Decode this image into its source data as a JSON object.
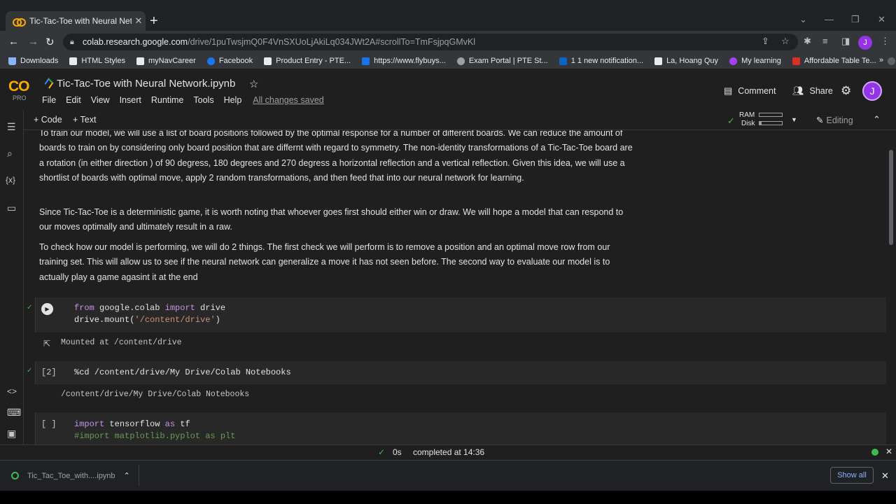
{
  "browser": {
    "tab_title": "Tic-Tac-Toe with Neural Network",
    "url_domain": "colab.research.google.com",
    "url_path": "/drive/1puTwsjmQ0F4VnSXUoLjAkiLq034JWt2A#scrollTo=TmFsjpqGMvKl",
    "profile_initial": "J"
  },
  "bookmarks": [
    {
      "label": "Downloads",
      "color": "#8ab4f8"
    },
    {
      "label": "HTML Styles",
      "color": "#e8eaed"
    },
    {
      "label": "myNavCareer",
      "color": "#e8eaed"
    },
    {
      "label": "Facebook",
      "color": "#1877f2"
    },
    {
      "label": "Product Entry - PTE...",
      "color": "#e8eaed"
    },
    {
      "label": "https://www.flybuys...",
      "color": "#1a73e8"
    },
    {
      "label": "Exam Portal | PTE St...",
      "color": "#9aa0a6"
    },
    {
      "label": "1 1 new notification...",
      "color": "#0a66c2"
    },
    {
      "label": "La, Hoang Quy",
      "color": "#e8eaed"
    },
    {
      "label": "My learning",
      "color": "#a142f4"
    },
    {
      "label": "Affordable Table Te...",
      "color": "#d93025"
    }
  ],
  "colab": {
    "logo": "CO",
    "pro_label": "PRO",
    "notebook_title": "Tic-Tac-Toe with Neural Network.ipynb",
    "menu": [
      "File",
      "Edit",
      "View",
      "Insert",
      "Runtime",
      "Tools",
      "Help"
    ],
    "saved_status": "All changes saved",
    "comment_label": "Comment",
    "share_label": "Share",
    "avatar_initial": "J",
    "add_code": "+ Code",
    "add_text": "+ Text",
    "ram_label": "RAM",
    "disk_label": "Disk",
    "editing_label": "Editing"
  },
  "text_cells": [
    "To train our model, we will use a list of board positions followed by the optimal response for a number of different boards. We can reduce the amount of boards to train on by considering only board position that are differnt with regard to symmetry. The non-identity transformations of a Tic-Tac-Toe board are a rotation (in either direction ) of 90 degress, 180 degrees and 270 degress a horizontal reflection and a vertical reflection. Given this idea, we will use a shortlist of boards with optimal move, apply 2 random transformations, and then feed that into our neural network for learning.",
    "Since Tic-Tac-Toe is a deterministic game, it is worth noting that whoever goes first should either win or draw. We will hope a model that can respond to our moves optimally and ultimately result in a raw.",
    "To check how our model is performing, we will do 2 things. The first check we will perform is to remove a position and an optimal move row from our training set. This will allow us to see if the neural network can generalize a move it has not seen before. The second way to evaluate our model is to actually play a game agasint it at the end"
  ],
  "code_cells": [
    {
      "count": "",
      "line1_a": "from ",
      "line1_b": "google.colab ",
      "line1_c": "import",
      "line1_d": " drive",
      "line2_a": "drive.mount(",
      "line2_b": "'/content/drive'",
      "line2_c": ")",
      "output": "Mounted at /content/drive"
    },
    {
      "count": "[2]",
      "line1": "%cd /content/drive/My Drive/Colab Notebooks",
      "output": "/content/drive/My Drive/Colab Notebooks"
    },
    {
      "count": "[ ]",
      "line1_a": "import",
      "line1_b": " tensorflow ",
      "line1_c": "as",
      "line1_d": " tf",
      "line2": "#import matplotlib.pyplot as plt"
    }
  ],
  "status_bar": {
    "duration": "0s",
    "completed": "completed at 14:36"
  },
  "download_shelf": {
    "file": "Tic_Tac_Toe_with....ipynb",
    "show_all": "Show all"
  }
}
